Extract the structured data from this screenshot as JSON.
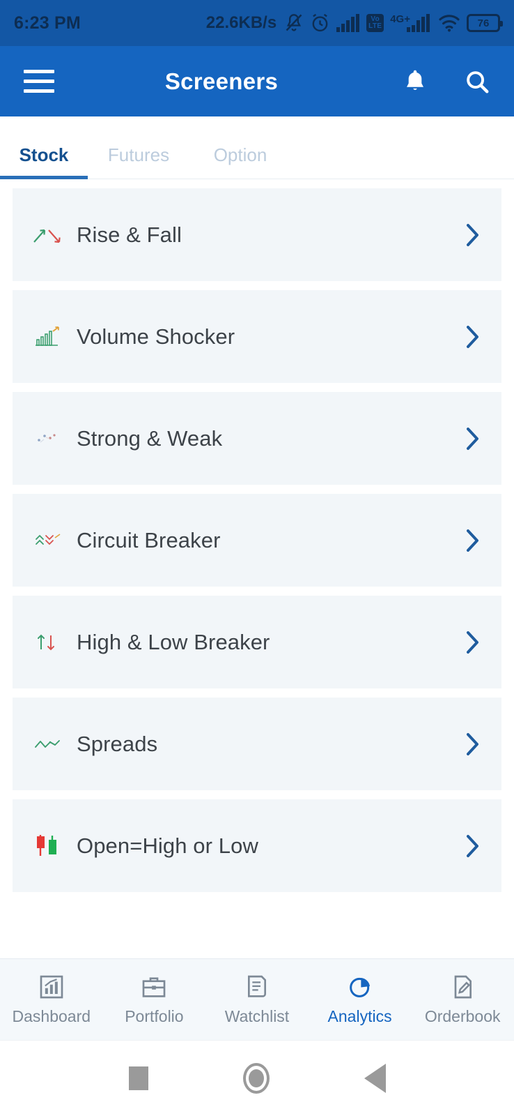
{
  "status_bar": {
    "time": "6:23 PM",
    "network_speed": "22.6KB/s",
    "icons": [
      "bell-muted-icon",
      "alarm-clock-icon",
      "signal-bars-icon",
      "volte-icon",
      "signal-bars-2-icon",
      "wifi-icon",
      "battery-icon"
    ],
    "volte_label_top": "Vo",
    "volte_label_bottom": "LTE",
    "network_generation": "4G+",
    "battery_level": "76"
  },
  "app_bar": {
    "menu_icon": "hamburger-menu-icon",
    "title": "Screeners",
    "notification_icon": "bell-icon",
    "search_icon": "search-icon",
    "background_color": "#1565c0"
  },
  "tabs": {
    "active_color": "#14508f",
    "inactive_color": "#bcccdd",
    "items": [
      {
        "label": "Stock",
        "active": true
      },
      {
        "label": "Futures",
        "active": false
      },
      {
        "label": "Option",
        "active": false
      }
    ]
  },
  "screeners": {
    "chevron_color": "#1f5c9e",
    "row_background": "#f2f6f9",
    "items": [
      {
        "label": "Rise & Fall",
        "icon": "arrow-up-down-icon"
      },
      {
        "label": "Volume Shocker",
        "icon": "bar-chart-icon"
      },
      {
        "label": "Strong & Weak",
        "icon": "scatter-dots-icon"
      },
      {
        "label": "Circuit Breaker",
        "icon": "double-chevron-up-down-icon"
      },
      {
        "label": "High & Low Breaker",
        "icon": "up-down-arrows-icon"
      },
      {
        "label": "Spreads",
        "icon": "line-chart-icon"
      },
      {
        "label": "Open=High or Low",
        "icon": "candlestick-icon"
      }
    ]
  },
  "bottom_nav": {
    "active_color": "#1565c0",
    "inactive_color": "#7d8996",
    "items": [
      {
        "label": "Dashboard",
        "icon": "dashboard-chart-icon",
        "active": false
      },
      {
        "label": "Portfolio",
        "icon": "briefcase-icon",
        "active": false
      },
      {
        "label": "Watchlist",
        "icon": "list-document-icon",
        "active": false
      },
      {
        "label": "Analytics",
        "icon": "pie-chart-icon",
        "active": true
      },
      {
        "label": "Orderbook",
        "icon": "edit-document-icon",
        "active": false
      }
    ]
  },
  "android_nav": {
    "recents": "square-recents-icon",
    "home": "circle-home-icon",
    "back": "triangle-back-icon"
  }
}
